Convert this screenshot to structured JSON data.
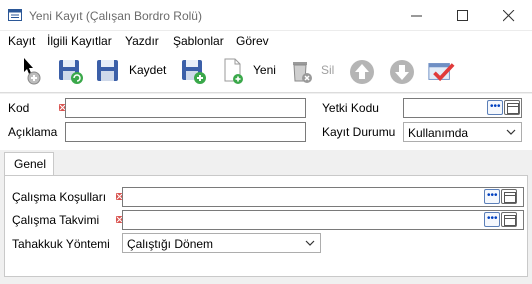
{
  "window": {
    "title": "Yeni Kayıt (Çalışan Bordro Rolü)"
  },
  "menu": {
    "items": [
      "Kayıt",
      "İlgili Kayıtlar",
      "Yazdır",
      "Şablonlar",
      "Görev"
    ]
  },
  "toolbar": {
    "save_label": "Kaydet",
    "new_label": "Yeni",
    "delete_label": "Sil"
  },
  "form": {
    "code_label": "Kod",
    "code_value": "",
    "description_label": "Açıklama",
    "description_value": "",
    "authority_code_label": "Yetki Kodu",
    "authority_code_value": "",
    "record_status_label": "Kayıt Durumu",
    "record_status_value": "Kullanımda"
  },
  "tabs": {
    "general_label": "Genel"
  },
  "general": {
    "working_conditions_label": "Çalışma Koşulları",
    "working_conditions_value": "",
    "working_calendar_label": "Çalışma Takvimi",
    "working_calendar_value": "",
    "accrual_method_label": "Tahakkuk Yöntemi",
    "accrual_method_value": "Çalıştığı Dönem"
  },
  "colors": {
    "required_marker": "#d9534f",
    "lookup_blue": "#0040c0"
  }
}
